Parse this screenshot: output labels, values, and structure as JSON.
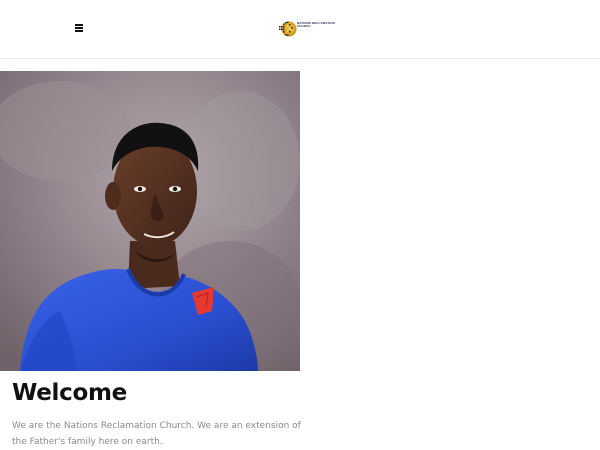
{
  "header": {
    "menu_icon": "hamburger-menu-icon",
    "logo": {
      "name": "church-logo",
      "colors": [
        "#1b2a52",
        "#d8a21b"
      ]
    }
  },
  "hero": {
    "image": "man-in-blue-outfit-photo",
    "colors": {
      "backdrop": "#8f8189",
      "shirt": "#2a4fd1",
      "pocket_square": "#e6392f"
    }
  },
  "welcome": {
    "title": "Welcome",
    "text": "We are the Nations Reclamation Church. We are an extension of the Father's family here on earth."
  }
}
